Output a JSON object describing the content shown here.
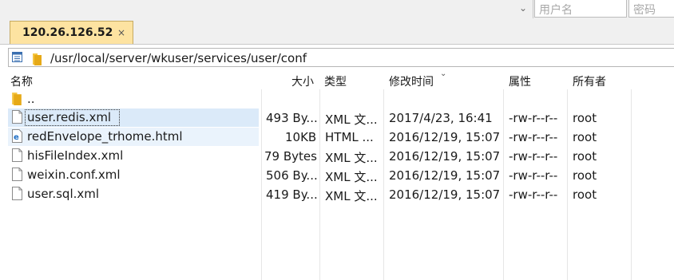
{
  "toolbar": {
    "username_placeholder": "用户名",
    "password_placeholder": "密码"
  },
  "tab": {
    "label": "120.26.126.52",
    "close": "×"
  },
  "path": {
    "value": "/usr/local/server/wkuser/services/user/conf"
  },
  "columns": {
    "name": "名称",
    "size": "大小",
    "type": "类型",
    "modified": "修改时间",
    "perm": "属性",
    "owner": "所有者"
  },
  "parent": {
    "name": ".."
  },
  "files": [
    {
      "name": "user.redis.xml",
      "size": "493 By...",
      "type": "XML 文...",
      "modified": "2017/4/23, 16:41",
      "perm": "-rw-r--r--",
      "owner": "root",
      "icon": "file-icon"
    },
    {
      "name": "redEnvelope_trhome.html",
      "size": "10KB",
      "type": "HTML ...",
      "modified": "2016/12/19, 15:07",
      "perm": "-rw-r--r--",
      "owner": "root",
      "icon": "edge-html-icon"
    },
    {
      "name": "hisFileIndex.xml",
      "size": "79 Bytes",
      "type": "XML 文...",
      "modified": "2016/12/19, 15:07",
      "perm": "-rw-r--r--",
      "owner": "root",
      "icon": "file-icon"
    },
    {
      "name": "weixin.conf.xml",
      "size": "506 By...",
      "type": "XML 文...",
      "modified": "2016/12/19, 15:07",
      "perm": "-rw-r--r--",
      "owner": "root",
      "icon": "file-icon"
    },
    {
      "name": "user.sql.xml",
      "size": "419 By...",
      "type": "XML 文...",
      "modified": "2016/12/19, 15:07",
      "perm": "-rw-r--r--",
      "owner": "root",
      "icon": "file-icon"
    }
  ]
}
